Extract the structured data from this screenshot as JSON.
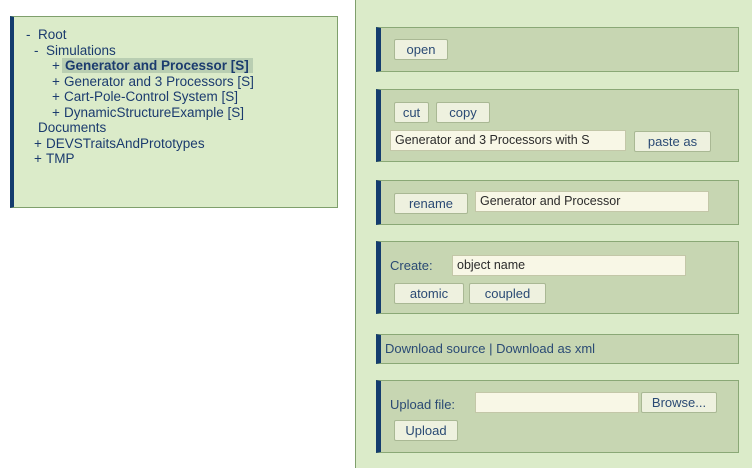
{
  "tree": {
    "root": {
      "toggle": "-",
      "label": "Root"
    },
    "simulations": {
      "toggle": "-",
      "label": "Simulations"
    },
    "items": [
      {
        "toggle": "+",
        "label": "Generator and Processor [S]"
      },
      {
        "toggle": "+",
        "label": "Generator and 3 Processors [S]"
      },
      {
        "toggle": "+",
        "label": "Cart-Pole-Control System [S]"
      },
      {
        "toggle": "+",
        "label": "DynamicStructureExample [S]"
      }
    ],
    "documents": {
      "label": "Documents"
    },
    "devs": {
      "toggle": "+",
      "label": "DEVSTraitsAndPrototypes"
    },
    "tmp": {
      "toggle": "+",
      "label": "TMP"
    }
  },
  "actions": {
    "open_label": "open",
    "cut_label": "cut",
    "copy_label": "copy",
    "clipboard_value": "Generator and 3 Processors with S",
    "paste_as_label": "paste as",
    "rename_label": "rename",
    "rename_value": "Generator and Processor",
    "create_label": "Create:",
    "create_value": "object name",
    "atomic_label": "atomic",
    "coupled_label": "coupled",
    "download_source": "Download source",
    "download_separator": " | ",
    "download_xml": "Download as xml",
    "upload_label": "Upload file:",
    "upload_value": "",
    "browse_label": "Browse...",
    "upload_button": "Upload"
  }
}
